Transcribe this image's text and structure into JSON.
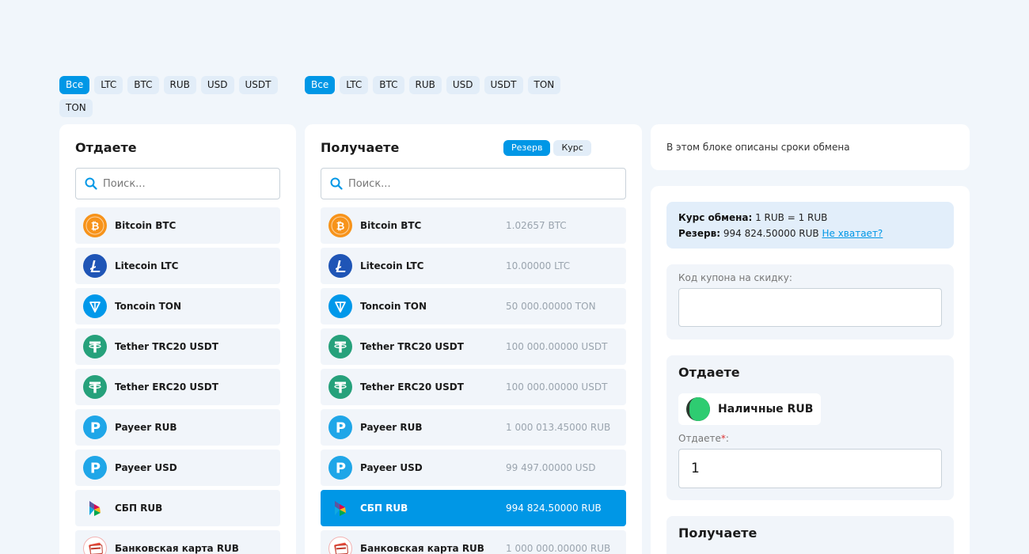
{
  "filters_give": [
    "Все",
    "LTC",
    "BTC",
    "RUB",
    "USD",
    "USDT",
    "TON"
  ],
  "filters_get": [
    "Все",
    "LTC",
    "BTC",
    "RUB",
    "USD",
    "USDT",
    "TON"
  ],
  "give_panel": {
    "title": "Отдаете",
    "search_placeholder": "Поиск...",
    "items": [
      {
        "name": "Bitcoin BTC",
        "icon": "bitcoin-icon",
        "color": "#f7931a"
      },
      {
        "name": "Litecoin LTC",
        "icon": "litecoin-icon",
        "color": "#1f55b6"
      },
      {
        "name": "Toncoin TON",
        "icon": "toncoin-icon",
        "color": "#0098ea"
      },
      {
        "name": "Tether TRC20 USDT",
        "icon": "tether-icon",
        "color": "#26a17b"
      },
      {
        "name": "Tether ERC20 USDT",
        "icon": "tether-icon",
        "color": "#26a17b"
      },
      {
        "name": "Payeer RUB",
        "icon": "payeer-icon",
        "color": "#1fa6e8"
      },
      {
        "name": "Payeer USD",
        "icon": "payeer-icon",
        "color": "#1fa6e8"
      },
      {
        "name": "СБП RUB",
        "icon": "sbp-icon",
        "color": "#ffffff"
      },
      {
        "name": "Банковская карта RUB",
        "icon": "bank-card-icon",
        "color": "#ffffff"
      }
    ]
  },
  "get_panel": {
    "title": "Получаете",
    "toggle": [
      "Резерв",
      "Курс"
    ],
    "search_placeholder": "Поиск...",
    "items": [
      {
        "name": "Bitcoin BTC",
        "reserve": "1.02657 BTC",
        "icon": "bitcoin-icon",
        "color": "#f7931a"
      },
      {
        "name": "Litecoin LTC",
        "reserve": "10.00000 LTC",
        "icon": "litecoin-icon",
        "color": "#1f55b6"
      },
      {
        "name": "Toncoin TON",
        "reserve": "50 000.00000 TON",
        "icon": "toncoin-icon",
        "color": "#0098ea"
      },
      {
        "name": "Tether TRC20 USDT",
        "reserve": "100 000.00000 USDT",
        "icon": "tether-icon",
        "color": "#26a17b"
      },
      {
        "name": "Tether ERC20 USDT",
        "reserve": "100 000.00000 USDT",
        "icon": "tether-icon",
        "color": "#26a17b"
      },
      {
        "name": "Payeer RUB",
        "reserve": "1 000 013.45000 RUB",
        "icon": "payeer-icon",
        "color": "#1fa6e8"
      },
      {
        "name": "Payeer USD",
        "reserve": "99 497.00000 USD",
        "icon": "payeer-icon",
        "color": "#1fa6e8"
      },
      {
        "name": "СБП RUB",
        "reserve": "994 824.50000 RUB",
        "icon": "sbp-icon",
        "color": "#ffffff",
        "selected": true
      },
      {
        "name": "Банковская карта RUB",
        "reserve": "1 000 000.00000 RUB",
        "icon": "bank-card-icon",
        "color": "#ffffff"
      }
    ]
  },
  "info": {
    "text": "В этом блоке описаны сроки обмена"
  },
  "exchange": {
    "rate_label": "Курс обмена:",
    "rate_value": "1 RUB = 1 RUB",
    "reserve_label": "Резерв:",
    "reserve_value": "994 824.50000 RUB",
    "not_enough_link": "Не хватает?",
    "coupon_label": "Код купона на скидку:",
    "coupon_value": "",
    "give_title": "Отдаете",
    "give_currency": "Наличные RUB",
    "give_amount_label": "Отдаете",
    "give_amount_required": "*",
    "give_amount_suffix": ":",
    "give_amount_value": "1",
    "get_title": "Получаете"
  }
}
